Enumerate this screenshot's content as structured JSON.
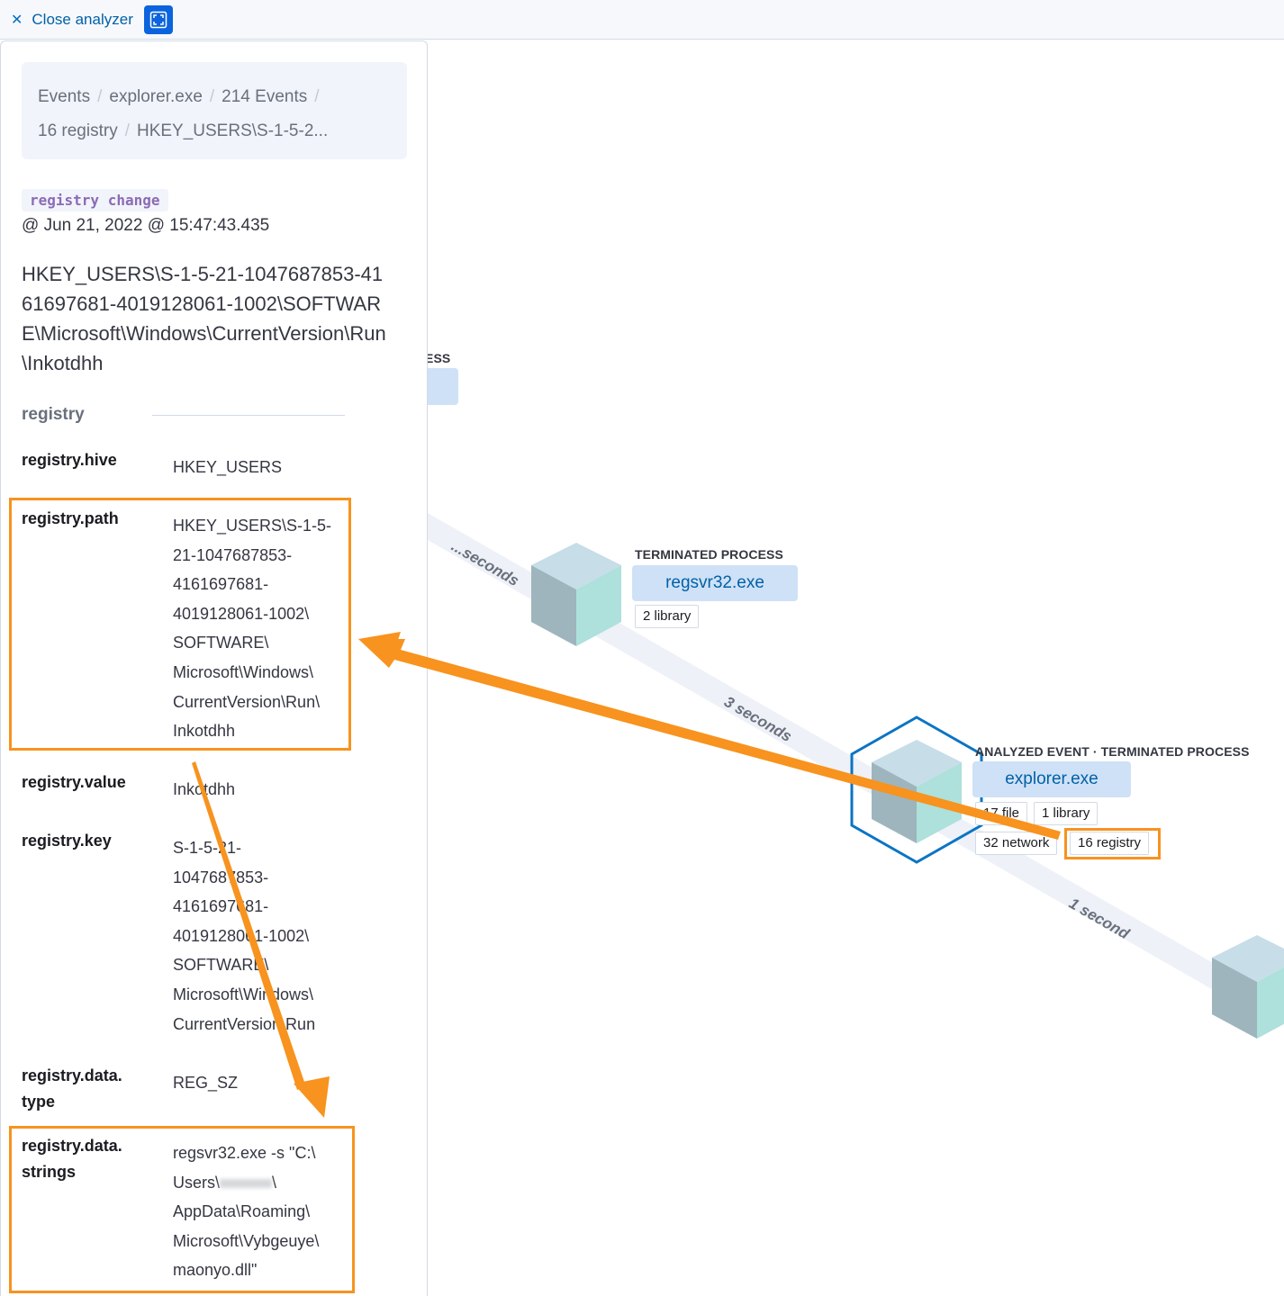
{
  "topbar": {
    "close_label": "Close analyzer",
    "close_icon": "close-icon",
    "fullscreen_icon": "fullscreen-icon"
  },
  "breadcrumbs": [
    "Events",
    "explorer.exe",
    "214 Events",
    "16 registry",
    "HKEY_USERS\\S-1-5-2..."
  ],
  "event": {
    "category_badge": "registry change",
    "timestamp": "@ Jun 21, 2022 @ 15:47:43.435",
    "title": "HKEY_USERS\\S-1-5-21-1047687853-4161697681-4019128061-1002\\SOFTWARE\\Microsoft\\Windows\\CurrentVersion\\Run\\Inkotdhh"
  },
  "section": {
    "title": "registry",
    "fields": [
      {
        "key": "registry.hive",
        "value": "HKEY_USERS"
      },
      {
        "key": "registry.path",
        "value": "HKEY_USERS\\S-1-5-21-1047687853-4161697681-4019128061-1002\\SOFTWARE\\Microsoft\\Windows\\CurrentVersion\\Run\\Inkotdhh",
        "highlighted": true
      },
      {
        "key": "registry.value",
        "value": "Inkotdhh"
      },
      {
        "key": "registry.key",
        "value": "S-1-5-21-1047687853-4161697681-4019128061-1002\\SOFTWARE\\Microsoft\\Windows\\CurrentVersion\\Run"
      },
      {
        "key": "registry.data.type",
        "value": "REG_SZ"
      },
      {
        "key": "registry.data.strings",
        "value": "regsvr32.exe -s \"C:\\Users\\[redacted]\\AppData\\Roaming\\Microsoft\\Vybgeuye\\maonyo.dll\"",
        "highlighted": true
      }
    ]
  },
  "graph": {
    "partial_node": {
      "label_fragment": "ESS"
    },
    "edges": [
      {
        "label": "...seconds"
      },
      {
        "label": "3 seconds"
      },
      {
        "label": "1 second"
      }
    ],
    "nodes": [
      {
        "state": "TERMINATED PROCESS",
        "name": "regsvr32.exe",
        "pills": [
          "2 library"
        ]
      },
      {
        "state": "ANALYZED EVENT · TERMINATED PROCESS",
        "name": "explorer.exe",
        "pills": [
          "17 file",
          "1 library",
          "32 network",
          "16 registry"
        ],
        "highlighted_pill": "16 registry"
      }
    ]
  },
  "colors": {
    "accent": "#0061a6",
    "highlight": "#f7931e",
    "node_fill": "#cfe1f7",
    "badge_text": "#8b6bb5"
  }
}
